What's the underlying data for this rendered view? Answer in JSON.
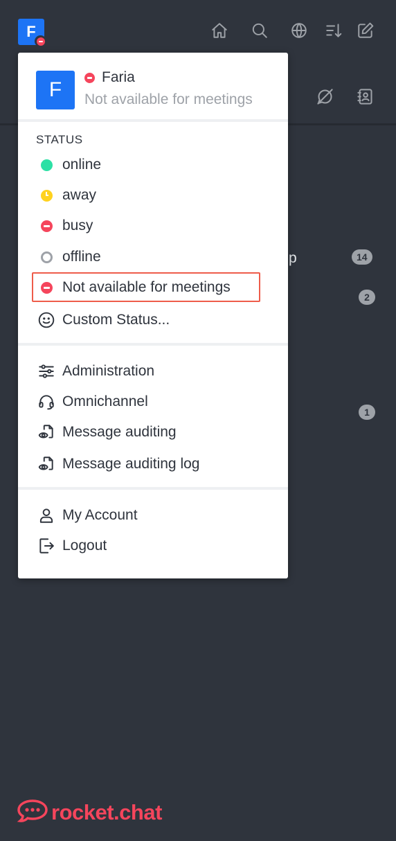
{
  "user": {
    "initial": "F",
    "name": "Faria",
    "status_text": "Not available for meetings"
  },
  "menu": {
    "status_label": "STATUS",
    "statuses": [
      {
        "label": "online",
        "color": "#2de0a5"
      },
      {
        "label": "away",
        "color": "#ffd21f"
      },
      {
        "label": "busy",
        "color": "#f5455c"
      },
      {
        "label": "offline",
        "color": "#9ea2a8"
      },
      {
        "label": "Not available for meetings",
        "color": "#f5455c",
        "selected": true
      },
      {
        "label": "Custom Status...",
        "icon": "smiley-icon"
      }
    ],
    "admin_items": [
      {
        "label": "Administration",
        "icon": "sliders-icon"
      },
      {
        "label": "Omnichannel",
        "icon": "headset-icon"
      },
      {
        "label": "Message auditing",
        "icon": "audit-icon"
      },
      {
        "label": "Message auditing log",
        "icon": "audit-log-icon"
      }
    ],
    "account_items": [
      {
        "label": "My Account",
        "icon": "user-icon"
      },
      {
        "label": "Logout",
        "icon": "logout-icon"
      }
    ]
  },
  "topbar": {
    "icons": [
      "home-icon",
      "search-icon",
      "directory-icon",
      "sort-icon",
      "write-icon"
    ]
  },
  "background": {
    "partial_text": "p",
    "badges": [
      "14",
      "2",
      "1"
    ]
  },
  "brand": {
    "text": "rocket.chat",
    "color": "#f5455c"
  }
}
